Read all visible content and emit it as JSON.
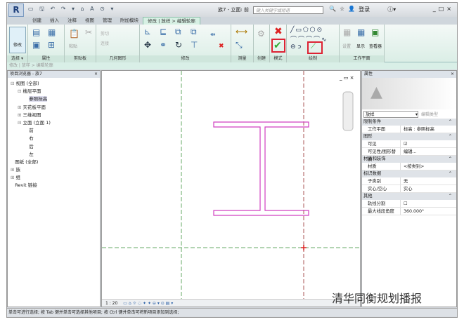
{
  "app": {
    "title": "族7 - 立面: 前",
    "search_placeholder": "键入关键字或短语",
    "login": "登录"
  },
  "tabs": [
    "创建",
    "插入",
    "注释",
    "视图",
    "管理",
    "附加模块",
    "修改 | 放样 > 编辑轮廓"
  ],
  "panels": {
    "select": "选择 ▾",
    "properties": "属性",
    "clipboard": "剪贴板",
    "geometry": "几何图形",
    "modify": "修改",
    "measure": "测量",
    "create": "创建",
    "mode": "模式",
    "draw": "绘制",
    "workplane": "工作平面"
  },
  "ribbon": {
    "modify_btn": "修改",
    "paste": "粘贴",
    "cut": "剪切",
    "join": "连接",
    "set": "设置",
    "show": "显示",
    "viewer": "查看器"
  },
  "breadcrumb": "修改 | 放样 > 编辑轮廓",
  "browser": {
    "title": "项目浏览器 - 族7",
    "items": [
      {
        "label": "视图 (全部)",
        "indent": 0,
        "sign": "⊟"
      },
      {
        "label": "楼层平面",
        "indent": 1,
        "sign": "⊟"
      },
      {
        "label": "参照标高",
        "indent": 2,
        "sign": "",
        "selected": true
      },
      {
        "label": "天花板平面",
        "indent": 1,
        "sign": "⊞"
      },
      {
        "label": "三维视图",
        "indent": 1,
        "sign": "⊞"
      },
      {
        "label": "立面 (立面 1)",
        "indent": 1,
        "sign": "⊟"
      },
      {
        "label": "前",
        "indent": 2,
        "sign": ""
      },
      {
        "label": "右",
        "indent": 2,
        "sign": ""
      },
      {
        "label": "后",
        "indent": 2,
        "sign": ""
      },
      {
        "label": "左",
        "indent": 2,
        "sign": ""
      },
      {
        "label": "图纸 (全部)",
        "indent": 0,
        "sign": ""
      },
      {
        "label": "族",
        "indent": 0,
        "sign": "⊞"
      },
      {
        "label": "组",
        "indent": 0,
        "sign": "⊞"
      },
      {
        "label": "Revit 链接",
        "indent": 0,
        "sign": ""
      }
    ]
  },
  "properties": {
    "title": "属性",
    "type": "放样",
    "edit_type": "编辑类型",
    "sections": [
      {
        "name": "限制条件",
        "rows": [
          {
            "k": "工作平面",
            "v": "标高 : 参照标高"
          }
        ]
      },
      {
        "name": "图形",
        "rows": [
          {
            "k": "可见",
            "v": "☑"
          },
          {
            "k": "可见性/图形替换",
            "v": "编辑..."
          }
        ]
      },
      {
        "name": "材质和装饰",
        "rows": [
          {
            "k": "材质",
            "v": "<按类别>"
          }
        ]
      },
      {
        "name": "标识数据",
        "rows": [
          {
            "k": "子类别",
            "v": "无"
          },
          {
            "k": "实心/空心",
            "v": "实心"
          }
        ]
      },
      {
        "name": "其他",
        "rows": [
          {
            "k": "轨线分割",
            "v": "☐"
          },
          {
            "k": "最大线段角度",
            "v": "360.000°"
          }
        ]
      }
    ]
  },
  "view": {
    "scale": "1 : 20"
  },
  "status": "单击可进行选择; 按 Tab 键并单击可选择其他项目; 按 Ctrl 键并单击可将新项目添加到选择;",
  "watermark": "清华同衡规划播报",
  "colors": {
    "profile": "#d040c0",
    "accent_red": "#d22",
    "ribbon": "#dbeee6"
  }
}
